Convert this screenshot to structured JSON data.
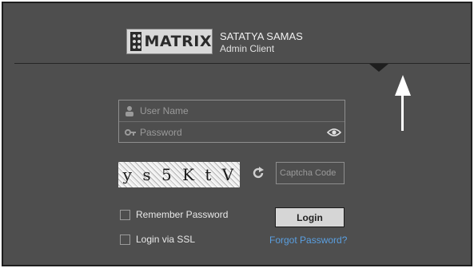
{
  "brand": {
    "logo_text": "MATRIX",
    "name": "SATATYA SAMAS",
    "subtitle": "Admin Client"
  },
  "login_form": {
    "username_placeholder": "User Name",
    "password_placeholder": "Password",
    "captcha_characters": [
      "y",
      "s",
      "5",
      "K",
      "t",
      "V"
    ],
    "captcha_placeholder": "Captcha Code",
    "remember_password_label": "Remember Password",
    "login_via_ssl_label": "Login via SSL",
    "login_button_label": "Login",
    "forgot_password_label": "Forgot Password?"
  },
  "icons": {
    "user": "user-icon",
    "password": "key-icon",
    "show_password": "eye-icon",
    "refresh_captcha": "refresh-icon",
    "annotation": "arrow-up-icon"
  },
  "colors": {
    "background": "#4e4e4e",
    "link": "#5a9fe0",
    "button": "#d6d6d6"
  }
}
